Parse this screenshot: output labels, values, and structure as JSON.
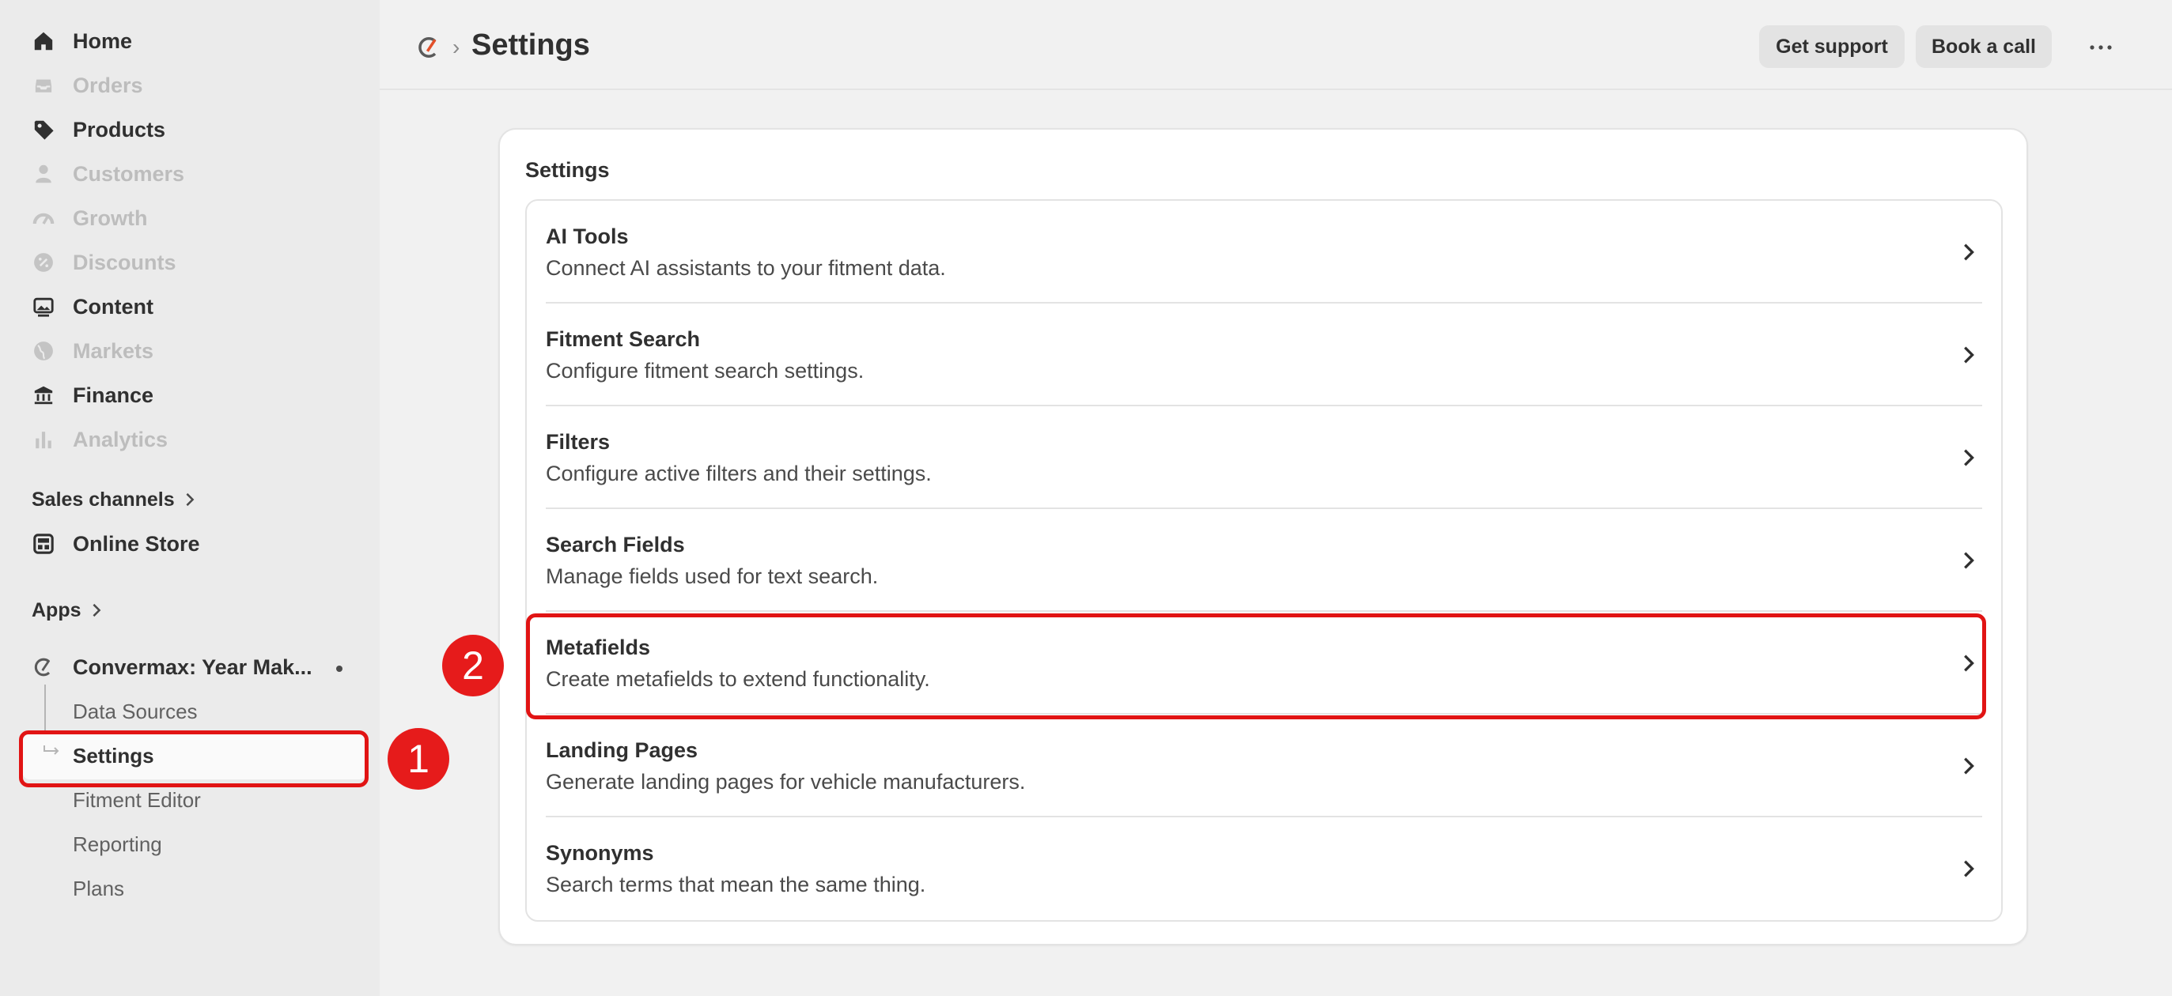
{
  "sidebar": {
    "nav": [
      {
        "label": "Home",
        "icon": "home-icon",
        "disabled": false
      },
      {
        "label": "Orders",
        "icon": "inbox-icon",
        "disabled": true
      },
      {
        "label": "Products",
        "icon": "tag-icon",
        "disabled": false
      },
      {
        "label": "Customers",
        "icon": "person-icon",
        "disabled": true
      },
      {
        "label": "Growth",
        "icon": "gauge-icon",
        "disabled": true
      },
      {
        "label": "Discounts",
        "icon": "discount-icon",
        "disabled": true
      },
      {
        "label": "Content",
        "icon": "image-icon",
        "disabled": false
      },
      {
        "label": "Markets",
        "icon": "globe-icon",
        "disabled": true
      },
      {
        "label": "Finance",
        "icon": "bank-icon",
        "disabled": false
      },
      {
        "label": "Analytics",
        "icon": "bar-chart-icon",
        "disabled": true
      }
    ],
    "sales_channels_label": "Sales channels",
    "online_store_label": "Online Store",
    "apps_label": "Apps",
    "app_name": "Convermax: Year Mak...",
    "app_sub_items": [
      "Data Sources",
      "Settings",
      "Fitment Editor",
      "Reporting",
      "Plans"
    ]
  },
  "header": {
    "title": "Settings",
    "support_label": "Get support",
    "call_label": "Book a call"
  },
  "card": {
    "title": "Settings",
    "items": [
      {
        "title": "AI Tools",
        "desc": "Connect AI assistants to your fitment data."
      },
      {
        "title": "Fitment Search",
        "desc": "Configure fitment search settings."
      },
      {
        "title": "Filters",
        "desc": "Configure active filters and their settings."
      },
      {
        "title": "Search Fields",
        "desc": "Manage fields used for text search."
      },
      {
        "title": "Metafields",
        "desc": "Create metafields to extend functionality."
      },
      {
        "title": "Landing Pages",
        "desc": "Generate landing pages for vehicle manufacturers."
      },
      {
        "title": "Synonyms",
        "desc": "Search terms that mean the same thing."
      }
    ]
  },
  "annotations": {
    "step1": "1",
    "step2": "2"
  },
  "colors": {
    "annotation_red": "#e11414",
    "sidebar_bg": "#ebebeb",
    "page_bg": "#f1f1f1"
  }
}
